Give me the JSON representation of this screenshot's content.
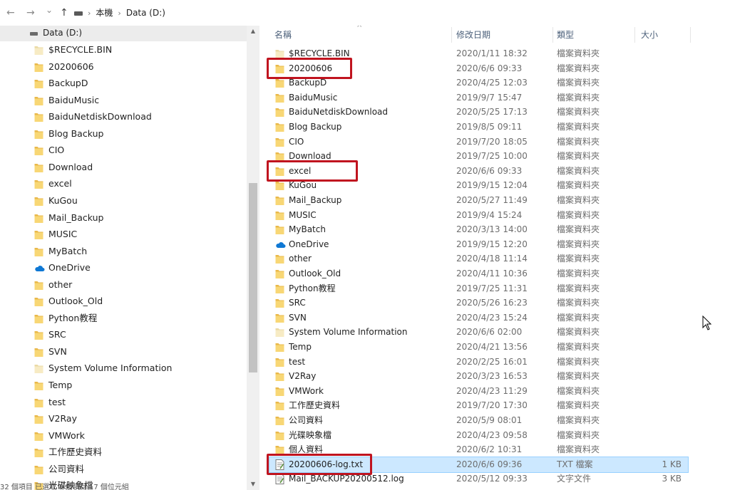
{
  "toolbar": {
    "back_glyph": "←",
    "forward_glyph": "→",
    "history_glyph": "⌄",
    "up_glyph": "↑",
    "breadcrumb": [
      "本機",
      "Data (D:)"
    ],
    "breadcrumb_sep": "›"
  },
  "nav_pane": {
    "drive": "Data (D:)",
    "items": [
      {
        "label": "$RECYCLE.BIN",
        "icon": "folder-system"
      },
      {
        "label": "20200606",
        "icon": "folder"
      },
      {
        "label": "BackupD",
        "icon": "folder"
      },
      {
        "label": "BaiduMusic",
        "icon": "folder"
      },
      {
        "label": "BaiduNetdiskDownload",
        "icon": "folder"
      },
      {
        "label": "Blog Backup",
        "icon": "folder"
      },
      {
        "label": "CIO",
        "icon": "folder"
      },
      {
        "label": "Download",
        "icon": "folder"
      },
      {
        "label": "excel",
        "icon": "folder"
      },
      {
        "label": "KuGou",
        "icon": "folder"
      },
      {
        "label": "Mail_Backup",
        "icon": "folder"
      },
      {
        "label": "MUSIC",
        "icon": "folder"
      },
      {
        "label": "MyBatch",
        "icon": "folder"
      },
      {
        "label": "OneDrive",
        "icon": "cloud"
      },
      {
        "label": "other",
        "icon": "folder"
      },
      {
        "label": "Outlook_Old",
        "icon": "folder"
      },
      {
        "label": "Python教程",
        "icon": "folder"
      },
      {
        "label": "SRC",
        "icon": "folder"
      },
      {
        "label": "SVN",
        "icon": "folder"
      },
      {
        "label": "System Volume Information",
        "icon": "folder-system"
      },
      {
        "label": "Temp",
        "icon": "folder"
      },
      {
        "label": "test",
        "icon": "folder"
      },
      {
        "label": "V2Ray",
        "icon": "folder"
      },
      {
        "label": "VMWork",
        "icon": "folder"
      },
      {
        "label": "工作歷史資料",
        "icon": "folder"
      },
      {
        "label": "公司資料",
        "icon": "folder"
      },
      {
        "label": "光碟映象檔",
        "icon": "folder"
      }
    ]
  },
  "columns": {
    "name": "名稱",
    "date": "修改日期",
    "type": "類型",
    "size": "大小",
    "sort_indicator": "^"
  },
  "files": [
    {
      "name": "$RECYCLE.BIN",
      "date": "2020/1/11 18:32",
      "type": "檔案資料夾",
      "size": "",
      "icon": "folder-system"
    },
    {
      "name": "20200606",
      "date": "2020/6/6 09:33",
      "type": "檔案資料夾",
      "size": "",
      "icon": "folder"
    },
    {
      "name": "BackupD",
      "date": "2020/4/25 12:03",
      "type": "檔案資料夾",
      "size": "",
      "icon": "folder"
    },
    {
      "name": "BaiduMusic",
      "date": "2019/9/7 15:47",
      "type": "檔案資料夾",
      "size": "",
      "icon": "folder"
    },
    {
      "name": "BaiduNetdiskDownload",
      "date": "2020/5/25 17:13",
      "type": "檔案資料夾",
      "size": "",
      "icon": "folder"
    },
    {
      "name": "Blog Backup",
      "date": "2019/8/5 09:11",
      "type": "檔案資料夾",
      "size": "",
      "icon": "folder"
    },
    {
      "name": "CIO",
      "date": "2019/7/20 18:05",
      "type": "檔案資料夾",
      "size": "",
      "icon": "folder"
    },
    {
      "name": "Download",
      "date": "2019/7/25 10:00",
      "type": "檔案資料夾",
      "size": "",
      "icon": "folder"
    },
    {
      "name": "excel",
      "date": "2020/6/6 09:33",
      "type": "檔案資料夾",
      "size": "",
      "icon": "folder"
    },
    {
      "name": "KuGou",
      "date": "2019/9/15 12:04",
      "type": "檔案資料夾",
      "size": "",
      "icon": "folder"
    },
    {
      "name": "Mail_Backup",
      "date": "2020/5/27 11:49",
      "type": "檔案資料夾",
      "size": "",
      "icon": "folder"
    },
    {
      "name": "MUSIC",
      "date": "2019/9/4 15:24",
      "type": "檔案資料夾",
      "size": "",
      "icon": "folder"
    },
    {
      "name": "MyBatch",
      "date": "2020/3/13 14:00",
      "type": "檔案資料夾",
      "size": "",
      "icon": "folder"
    },
    {
      "name": "OneDrive",
      "date": "2019/9/15 12:20",
      "type": "檔案資料夾",
      "size": "",
      "icon": "cloud"
    },
    {
      "name": "other",
      "date": "2020/4/18 11:14",
      "type": "檔案資料夾",
      "size": "",
      "icon": "folder"
    },
    {
      "name": "Outlook_Old",
      "date": "2020/4/11 10:36",
      "type": "檔案資料夾",
      "size": "",
      "icon": "folder"
    },
    {
      "name": "Python教程",
      "date": "2019/7/25 11:31",
      "type": "檔案資料夾",
      "size": "",
      "icon": "folder"
    },
    {
      "name": "SRC",
      "date": "2020/5/26 16:23",
      "type": "檔案資料夾",
      "size": "",
      "icon": "folder"
    },
    {
      "name": "SVN",
      "date": "2020/4/23 15:24",
      "type": "檔案資料夾",
      "size": "",
      "icon": "folder"
    },
    {
      "name": "System Volume Information",
      "date": "2020/6/6 02:00",
      "type": "檔案資料夾",
      "size": "",
      "icon": "folder-system"
    },
    {
      "name": "Temp",
      "date": "2020/4/21 13:56",
      "type": "檔案資料夾",
      "size": "",
      "icon": "folder"
    },
    {
      "name": "test",
      "date": "2020/2/25 16:01",
      "type": "檔案資料夾",
      "size": "",
      "icon": "folder"
    },
    {
      "name": "V2Ray",
      "date": "2020/3/23 16:53",
      "type": "檔案資料夾",
      "size": "",
      "icon": "folder"
    },
    {
      "name": "VMWork",
      "date": "2020/4/23 11:29",
      "type": "檔案資料夾",
      "size": "",
      "icon": "folder"
    },
    {
      "name": "工作歷史資料",
      "date": "2019/7/20 17:30",
      "type": "檔案資料夾",
      "size": "",
      "icon": "folder"
    },
    {
      "name": "公司資料",
      "date": "2020/5/9 08:01",
      "type": "檔案資料夾",
      "size": "",
      "icon": "folder"
    },
    {
      "name": "光碟映象檔",
      "date": "2020/4/23 09:58",
      "type": "檔案資料夾",
      "size": "",
      "icon": "folder"
    },
    {
      "name": "個人資料",
      "date": "2020/6/2 10:31",
      "type": "檔案資料夾",
      "size": "",
      "icon": "folder"
    },
    {
      "name": "20200606-log.txt",
      "date": "2020/6/6 09:36",
      "type": "TXT 檔案",
      "size": "1 KB",
      "icon": "text-file",
      "selected": true
    },
    {
      "name": "Mail_BACKUP20200512.log",
      "date": "2020/5/12 09:33",
      "type": "文字文件",
      "size": "3 KB",
      "icon": "text-file"
    }
  ],
  "highlights": [
    "20200606",
    "excel",
    "20200606-log.txt"
  ],
  "status": {
    "text": "32 個項目    已選取 1 個項目  17 個位元組"
  },
  "colors": {
    "folder_fill": "#f8d775",
    "folder_tab": "#e9b84a",
    "selection_bg": "#cce8ff",
    "selection_border": "#99d1ff",
    "highlight_red": "#c0141f",
    "onedrive_blue": "#0f78d4",
    "nav_selected_bg": "#ececec"
  }
}
